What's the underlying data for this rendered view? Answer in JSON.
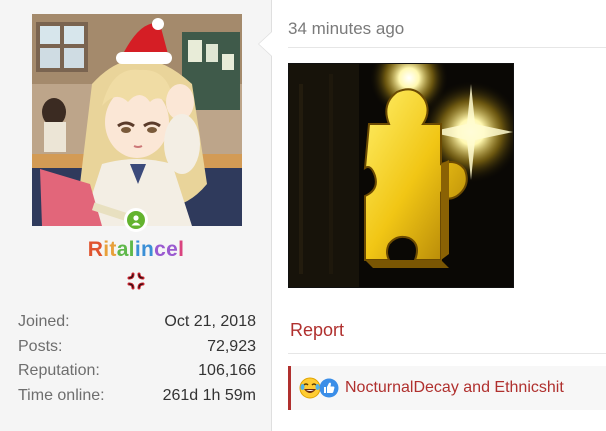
{
  "user": {
    "username": "Ritalincel",
    "username_gradient": [
      "#e0542f",
      "#e8a03a",
      "#5fb84a",
      "#3a8fd6",
      "#9a5ad0",
      "#d9437f"
    ],
    "online": true,
    "online_color": "#63b32e",
    "avatar_icon": "anime-girl-avatar",
    "badge_icon": "anger-symbol-icon",
    "stats": [
      {
        "label": "Joined:",
        "value": "Oct 21, 2018"
      },
      {
        "label": "Posts:",
        "value": "72,923"
      },
      {
        "label": "Reputation:",
        "value": "106,166"
      },
      {
        "label": "Time online:",
        "value": "261d 1h 59m"
      }
    ]
  },
  "post": {
    "timestamp": "34 minutes ago",
    "image_icon": "golden-puzzle-piece-image",
    "report_label": "Report",
    "accent_color": "#b0302e",
    "reactions": {
      "icons": [
        "laughing-face-icon",
        "thumbs-up-icon"
      ],
      "names": "NocturnalDecay and Ethnicshit"
    }
  }
}
